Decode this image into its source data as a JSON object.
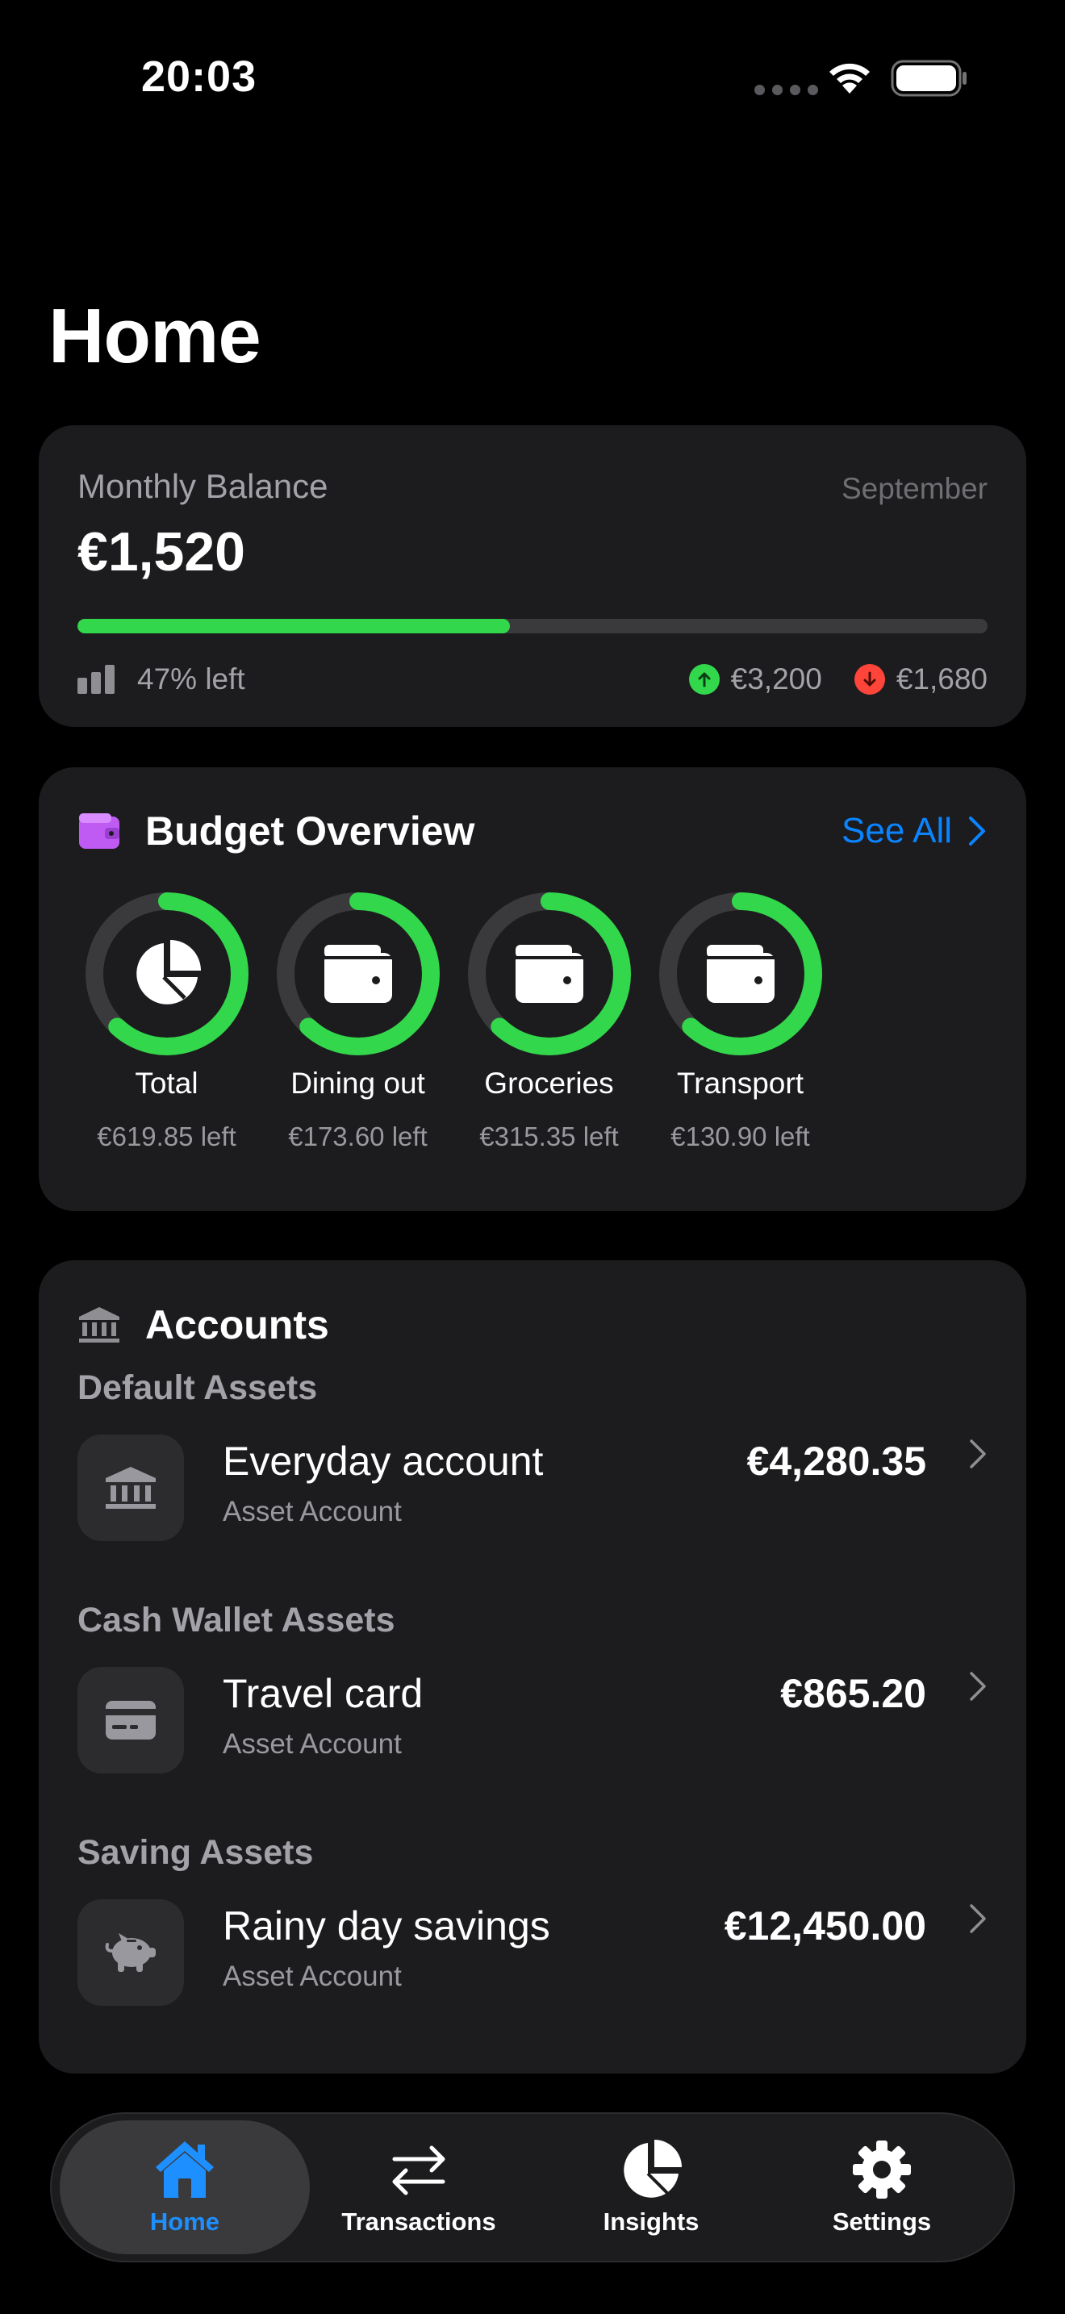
{
  "status_bar": {
    "time": "20:03"
  },
  "page": {
    "title": "Home"
  },
  "balance": {
    "label": "Monthly Balance",
    "month": "September",
    "amount": "€1,520",
    "progress_fraction": 0.475,
    "percent_left": "47% left",
    "income": "€3,200",
    "expense": "€1,680"
  },
  "budget": {
    "title": "Budget Overview",
    "see_all": "See All",
    "items": [
      {
        "name": "Total",
        "left": "€619.85 left",
        "icon": "pie-chart-icon",
        "fraction": 0.62
      },
      {
        "name": "Dining out",
        "left": "€173.60 left",
        "icon": "wallet-icon",
        "fraction": 0.62
      },
      {
        "name": "Groceries",
        "left": "€315.35 left",
        "icon": "wallet-icon",
        "fraction": 0.62
      },
      {
        "name": "Transport",
        "left": "€130.90 left",
        "icon": "wallet-icon",
        "fraction": 0.62
      }
    ]
  },
  "accounts": {
    "title": "Accounts",
    "groups": [
      {
        "title": "Default Assets",
        "name": "Everyday account",
        "type": "Asset Account",
        "amount": "€4,280.35",
        "icon": "bank-icon"
      },
      {
        "title": "Cash Wallet Assets",
        "name": "Travel card",
        "type": "Asset Account",
        "amount": "€865.20",
        "icon": "card-icon"
      },
      {
        "title": "Saving Assets",
        "name": "Rainy day savings",
        "type": "Asset Account",
        "amount": "€12,450.00",
        "icon": "piggy-bank-icon"
      }
    ]
  },
  "tabs": [
    {
      "label": "Home",
      "icon": "home-icon",
      "active": true
    },
    {
      "label": "Transactions",
      "icon": "arrows-icon",
      "active": false
    },
    {
      "label": "Insights",
      "icon": "pie-chart-icon",
      "active": false
    },
    {
      "label": "Settings",
      "icon": "gear-icon",
      "active": false
    }
  ],
  "colors": {
    "accent_green": "#32d74b",
    "expense_red": "#ff453a",
    "link_blue": "#0a84ff",
    "budget_icon_purple": "#bf5af2"
  }
}
